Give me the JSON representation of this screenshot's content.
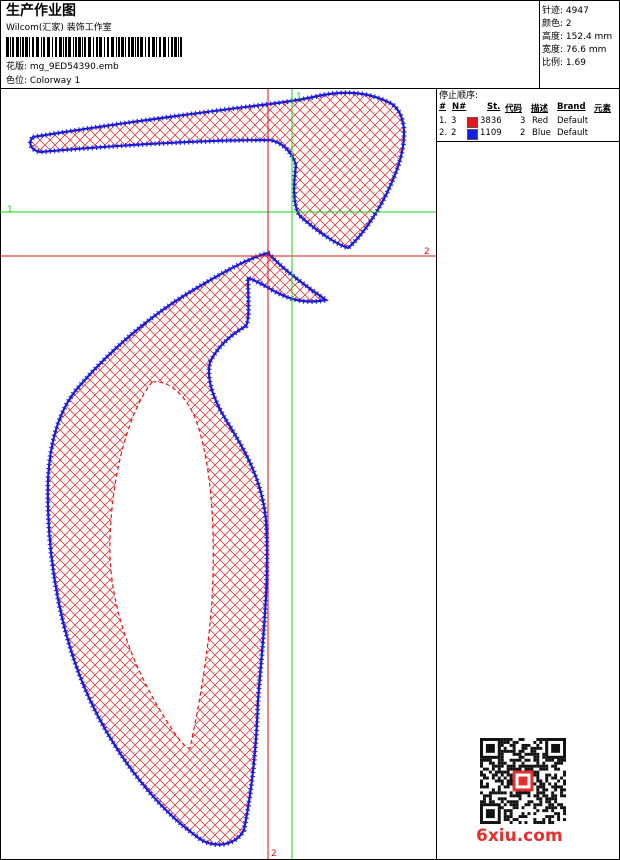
{
  "header": {
    "title": "生产作业图",
    "company": "Wilcom(汇家) 装饰工作室",
    "design_label": "花版:  mg_9ED54390.emb",
    "colorway_label": "色位:  Colorway 1"
  },
  "stats": [
    {
      "label": "针迹:",
      "value": "4947"
    },
    {
      "label": "颜色:",
      "value": "2"
    },
    {
      "label": "高度:",
      "value": "152.4 mm"
    },
    {
      "label": "宽度:",
      "value": "76.6 mm"
    },
    {
      "label": "比例:",
      "value": "1.69"
    }
  ],
  "stop_sequence": {
    "title": "停止顺序:",
    "columns": [
      "#",
      "N#",
      "St.",
      "代码",
      "描述",
      "Brand",
      "元素"
    ],
    "rows": [
      {
        "idx": "1.",
        "n": "3",
        "color": "#e8141a",
        "stitches": "3836",
        "code": "3",
        "desc": "Red",
        "brand": "Default"
      },
      {
        "idx": "2.",
        "n": "2",
        "color": "#1420e0",
        "stitches": "1109",
        "code": "2",
        "desc": "Blue",
        "brand": "Default"
      }
    ]
  },
  "guides": {
    "h1_label": "1",
    "h2_label": "2",
    "v1_label": "1",
    "v2_label": "2",
    "red_color": "#e01010",
    "green_color": "#18d018"
  },
  "colors": {
    "fill": "#e01818",
    "outline": "#1a1ad8"
  },
  "watermark": "6xiu.com"
}
